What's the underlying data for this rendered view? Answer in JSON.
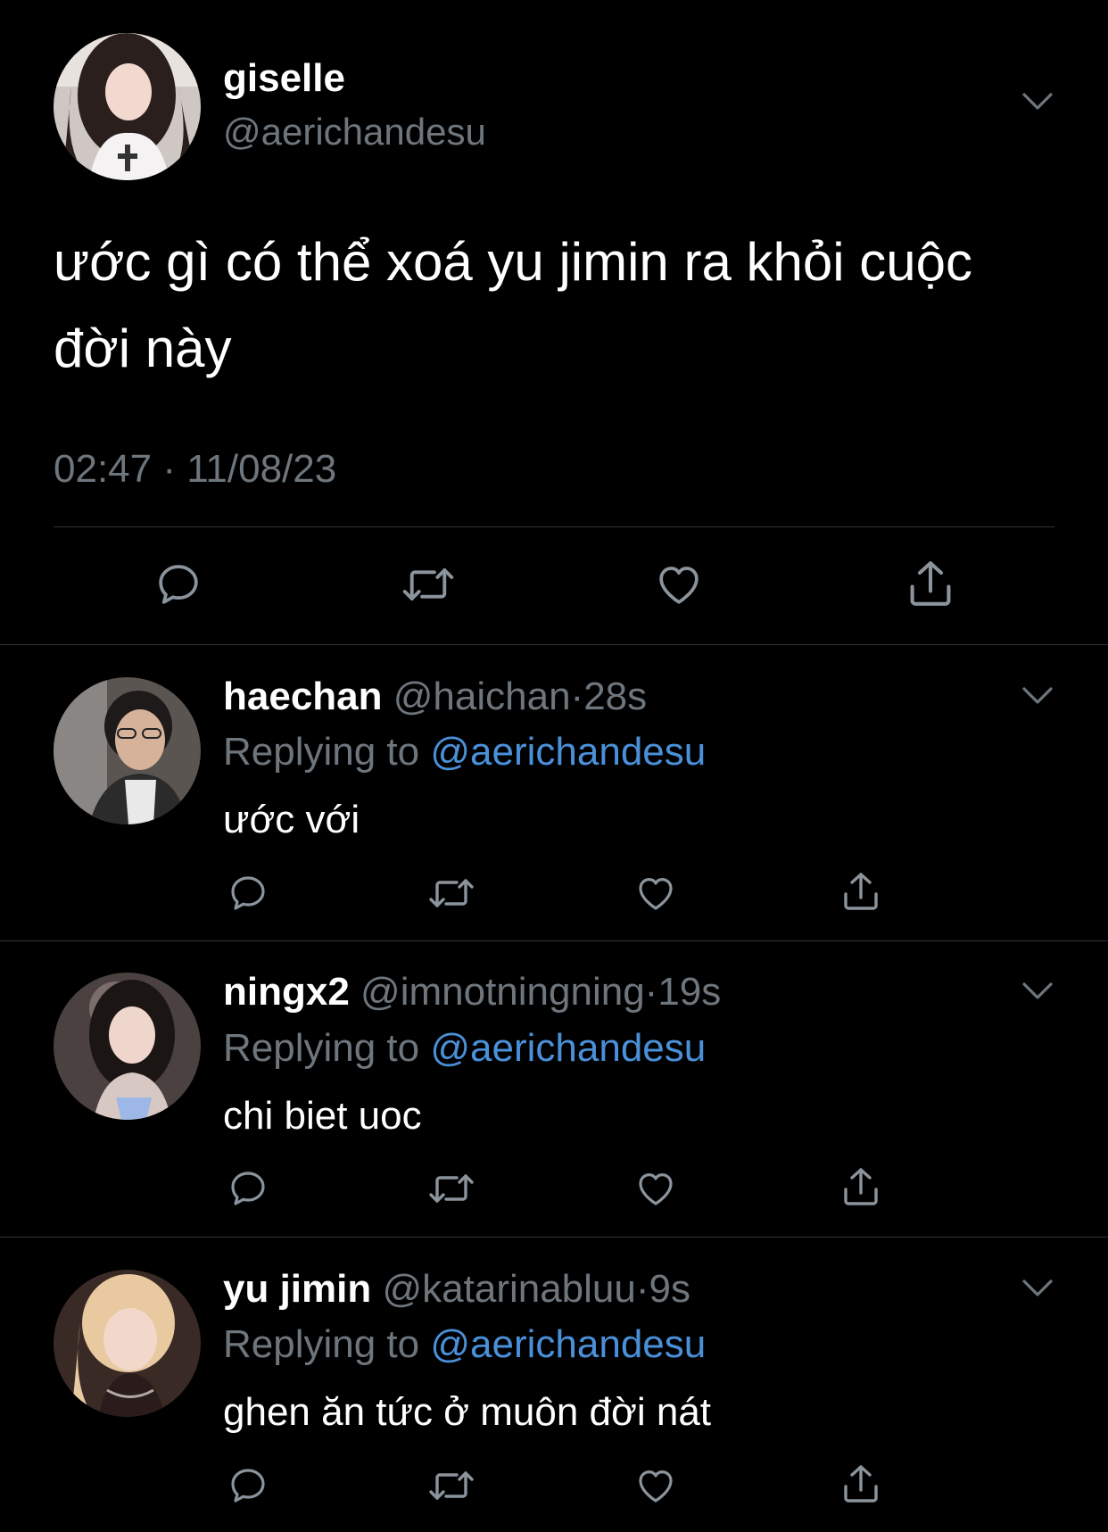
{
  "main_tweet": {
    "display_name": "giselle",
    "handle": "@aerichandesu",
    "text_line1": "ước gì có thể xoá yu jimin ra khỏi cuộc",
    "text_line2": "đời này",
    "timestamp": "02:47 · 11/08/23",
    "actions": [
      "reply-icon",
      "retweet-icon",
      "like-icon",
      "share-icon"
    ]
  },
  "replies": [
    {
      "display_name": "haechan",
      "handle": "@haichan",
      "dot": "·",
      "time": "28s",
      "replying_prefix": "Replying to",
      "replying_handle": "@aerichandesu",
      "text": "ước với"
    },
    {
      "display_name": "ningx2",
      "handle": "@imnotningning",
      "dot": "·",
      "time": "19s",
      "replying_prefix": "Replying to",
      "replying_handle": "@aerichandesu",
      "text": "chi biet uoc"
    },
    {
      "display_name": "yu jimin",
      "handle": "@katarinabluu",
      "dot": "·",
      "time": "9s",
      "replying_prefix": "Replying to",
      "replying_handle": "@aerichandesu",
      "text": "ghen ăn tức ở muôn đời nát"
    }
  ],
  "colors": {
    "background": "#000000",
    "text": "#e7e9ea",
    "muted": "#6e767d",
    "link": "#4a90d9",
    "divider": "#2f3336"
  }
}
